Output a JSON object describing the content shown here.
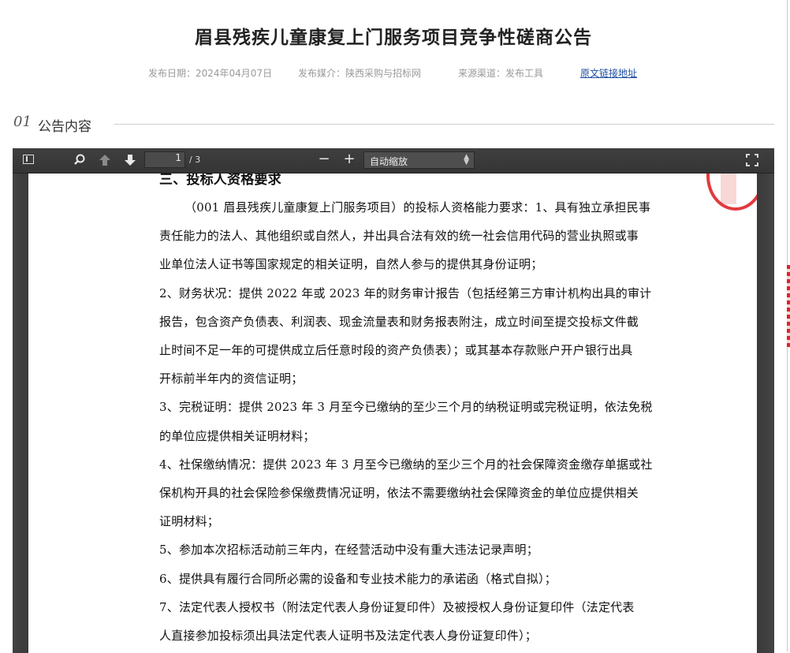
{
  "header": {
    "title": "眉县残疾儿童康复上门服务项目竞争性磋商公告",
    "publish_date": "发布日期：2024年04月07日",
    "publish_media": "发布媒介：陕西采购与招标网",
    "source_channel": "来源渠道：发布工具",
    "original_link": "原文链接地址"
  },
  "section": {
    "number": "01",
    "title": "公告内容"
  },
  "pdf_viewer": {
    "toolbar": {
      "sidebar_icon": "sidebar-toggle-icon",
      "search_icon": "magnifier-icon",
      "prev_icon": "arrow-up-icon",
      "next_icon": "arrow-down-icon",
      "page_current": "1",
      "page_total": "/ 3",
      "zoom_out": "−",
      "zoom_in": "+",
      "zoom_value": "自动缩放",
      "fullscreen_icon": "fullscreen-icon"
    },
    "page": {
      "heading": "三、投标人资格要求",
      "lines": [
        "（001 眉县残疾儿童康复上门服务项目）的投标人资格能力要求：1、具有独立承担民事",
        "责任能力的法人、其他组织或自然人，并出具合法有效的统一社会信用代码的营业执照或事",
        "业单位法人证书等国家规定的相关证明，自然人参与的提供其身份证明；",
        "2、财务状况：提供 2022 年或 2023 年的财务审计报告（包括经第三方审计机构出具的审计",
        "报告，包含资产负债表、利润表、现金流量表和财务报表附注，成立时间至提交投标文件截",
        "止时间不足一年的可提供成立后任意时段的资产负债表）；或其基本存款账户开户银行出具",
        "开标前半年内的资信证明；",
        "3、完税证明：提供 2023 年 3 月至今已缴纳的至少三个月的纳税证明或完税证明，依法免税",
        "的单位应提供相关证明材料；",
        "4、社保缴纳情况：提供 2023 年 3 月至今已缴纳的至少三个月的社会保障资金缴存单据或社",
        "保机构开具的社会保险参保缴费情况证明，依法不需要缴纳社会保障资金的单位应提供相关",
        "证明材料；",
        "5、参加本次招标活动前三年内，在经营活动中没有重大违法记录声明；",
        "6、提供具有履行合同所必需的设备和专业技术能力的承诺函（格式自拟）；",
        "7、法定代表人授权书（附法定代表人身份证复印件）及被授权人身份证复印件（法定代表",
        "人直接参加投标须出具法定代表人证明书及法定代表人身份证复印件）；"
      ]
    }
  }
}
